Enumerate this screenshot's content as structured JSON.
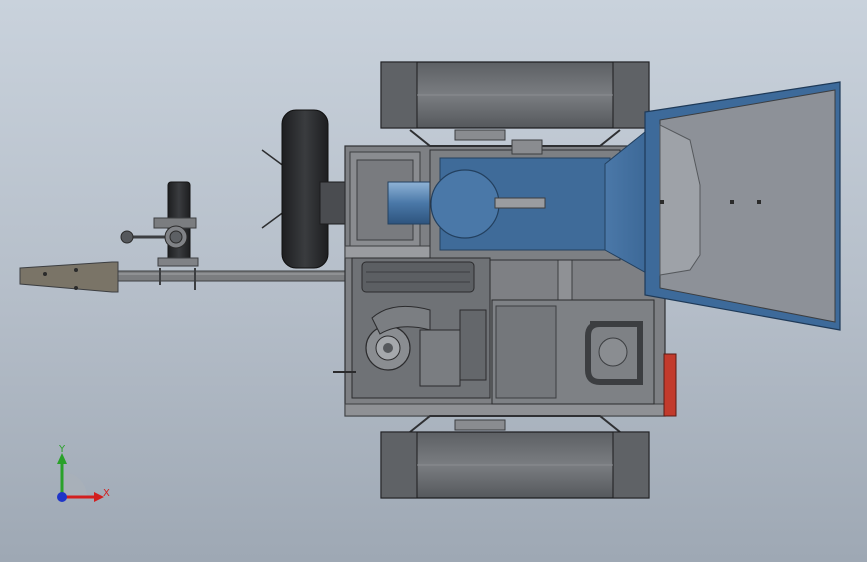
{
  "triad": {
    "x_label": "X",
    "y_label": "Y",
    "colors": {
      "x": "#d21f1f",
      "y": "#2aa12a",
      "z": "#1f35c8"
    }
  },
  "palette": {
    "steel": "#6e7175",
    "steel_dark": "#3c3e41",
    "hopper_blue": "#3d6a9a",
    "hopper_gray": "#8d9198",
    "tire": "#2a2b2d",
    "tail_light": "#c23a2c"
  }
}
